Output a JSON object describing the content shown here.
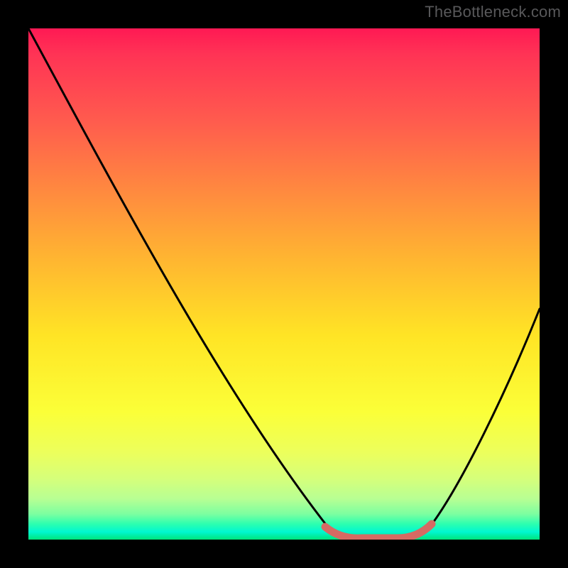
{
  "watermark": "TheBottleneck.com",
  "chart_data": {
    "type": "line",
    "title": "",
    "xlabel": "",
    "ylabel": "",
    "xlim": [
      0,
      100
    ],
    "ylim": [
      0,
      100
    ],
    "series": [
      {
        "name": "curve",
        "x": [
          0,
          10,
          20,
          30,
          40,
          50,
          58,
          62,
          66,
          70,
          74,
          80,
          90,
          100
        ],
        "y": [
          100,
          83,
          66,
          49,
          32,
          15,
          3,
          1,
          1,
          1,
          3,
          12,
          30,
          48
        ],
        "color": "#000000"
      },
      {
        "name": "minimum-band",
        "x": [
          58,
          62,
          66,
          70,
          74
        ],
        "y": [
          2,
          1,
          1,
          1,
          2
        ],
        "color": "#d66a63"
      }
    ],
    "annotations": [
      {
        "text": "TheBottleneck.com",
        "position": "top-right",
        "color": "#58585a"
      }
    ]
  }
}
